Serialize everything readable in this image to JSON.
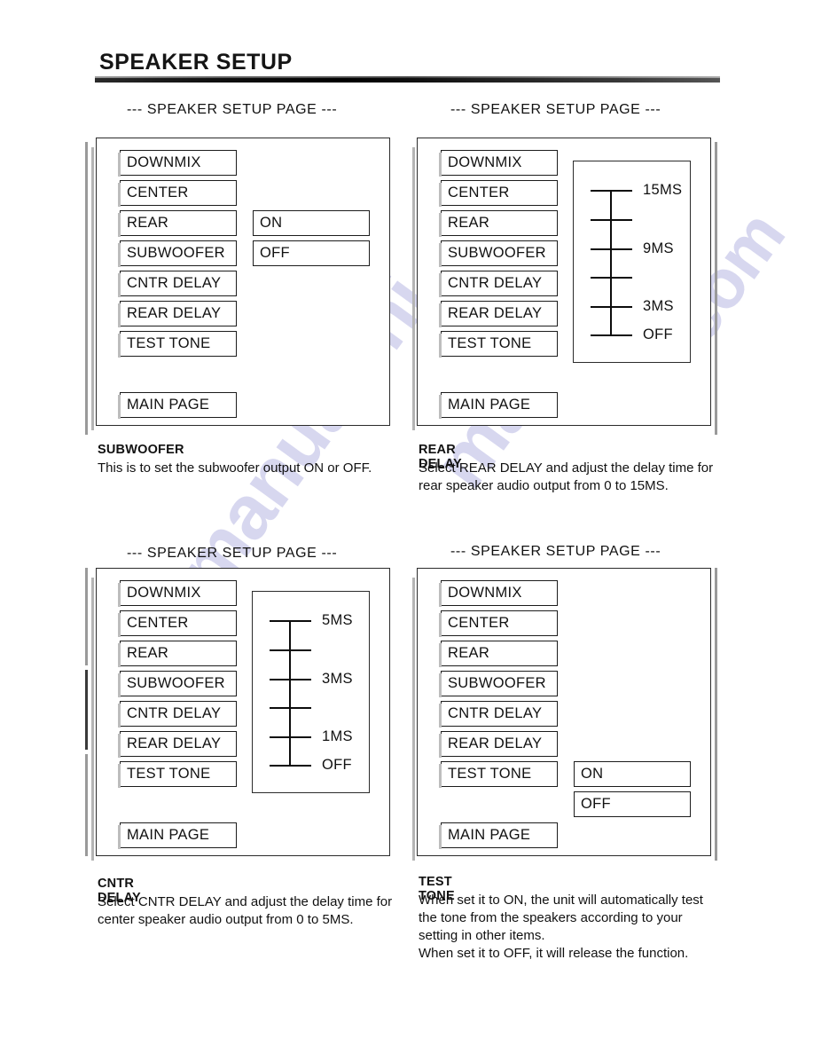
{
  "document": {
    "title": "SPEAKER SETUP"
  },
  "watermark": {
    "line1": "manualshi",
    "line2": "manuals",
    "line3": "s.com"
  },
  "screen_header": "--- SPEAKER SETUP PAGE ---",
  "menu_items": [
    "DOWNMIX",
    "CENTER",
    "REAR",
    "SUBWOOFER",
    "CNTR DELAY",
    "REAR DELAY",
    "TEST TONE"
  ],
  "main_page_label": "MAIN PAGE",
  "figures": [
    {
      "id": "subwoofer",
      "header": "--- SPEAKER SETUP PAGE ---",
      "options": [
        "ON",
        "OFF"
      ],
      "caption_title": "SUBWOOFER",
      "caption_body": "This is to set the subwoofer output ON or OFF."
    },
    {
      "id": "rear-delay",
      "header": "--- SPEAKER SETUP PAGE ---",
      "scale": {
        "labels": [
          "15MS",
          "9MS",
          "3MS",
          "OFF"
        ],
        "tick_count": 6,
        "unit": "MS",
        "range_min": 0,
        "range_max": 15
      },
      "caption_title": "REAR DELAY",
      "caption_body": "Select REAR DELAY and adjust the delay time for rear speaker audio output from 0 to 15MS."
    },
    {
      "id": "cntr-delay",
      "header": "--- SPEAKER SETUP PAGE ---",
      "scale": {
        "labels": [
          "5MS",
          "3MS",
          "1MS",
          "OFF"
        ],
        "tick_count": 6,
        "unit": "MS",
        "range_min": 0,
        "range_max": 5
      },
      "caption_title": "CNTR DELAY",
      "caption_body": "Select CNTR DELAY and adjust the delay time for center speaker audio output from 0 to 5MS."
    },
    {
      "id": "test-tone",
      "header": "--- SPEAKER SETUP PAGE ---",
      "options": [
        "ON",
        "OFF"
      ],
      "caption_title": "TEST TONE",
      "caption_body": "When set it to ON, the unit will automatically test the tone from the speakers according to your setting in other items.\nWhen set it to OFF, it will release the function."
    }
  ]
}
